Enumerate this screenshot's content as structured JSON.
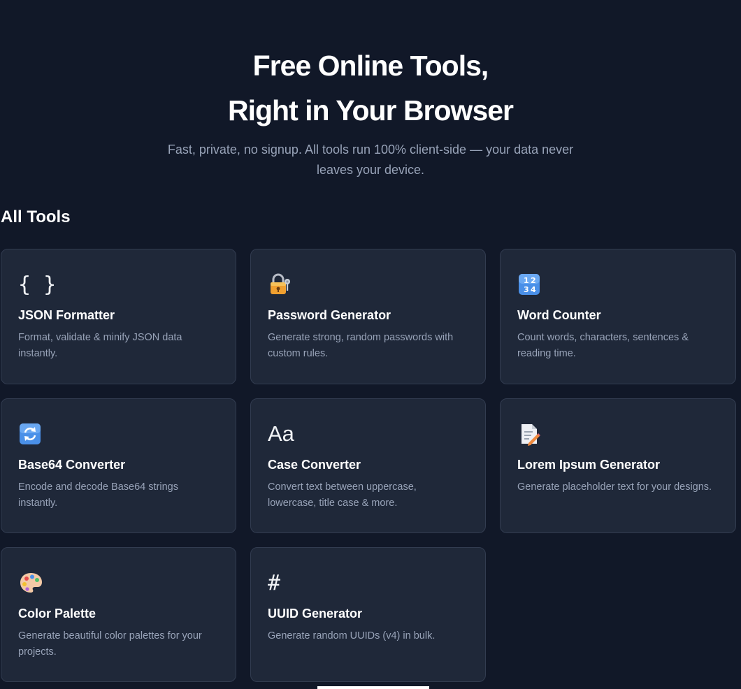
{
  "hero": {
    "title_line1": "Free Online Tools,",
    "title_line2": "Right in Your Browser",
    "subtitle": "Fast, private, no signup. All tools run 100% client-side — your data never leaves your device."
  },
  "section": {
    "title": "All Tools"
  },
  "tools": [
    {
      "icon": "braces-icon",
      "title": "JSON Formatter",
      "description": "Format, validate & minify JSON data instantly."
    },
    {
      "icon": "lock-key-icon",
      "title": "Password Generator",
      "description": "Generate strong, random passwords with custom rules."
    },
    {
      "icon": "numbers-icon",
      "title": "Word Counter",
      "description": "Count words, characters, sentences & reading time."
    },
    {
      "icon": "refresh-icon",
      "title": "Base64 Converter",
      "description": "Encode and decode Base64 strings instantly."
    },
    {
      "icon": "text-case-icon",
      "title": "Case Converter",
      "description": "Convert text between uppercase, lowercase, title case & more."
    },
    {
      "icon": "memo-icon",
      "title": "Lorem Ipsum Generator",
      "description": "Generate placeholder text for your designs."
    },
    {
      "icon": "palette-icon",
      "title": "Color Palette",
      "description": "Generate beautiful color palettes for your projects."
    },
    {
      "icon": "hash-icon",
      "title": "UUID Generator",
      "description": "Generate random UUIDs (v4) in bulk."
    }
  ],
  "icon_glyphs": {
    "braces": "{ }",
    "text_case": "Aa",
    "hash": "#"
  },
  "colors": {
    "background": "#111828",
    "card": "#1f2839",
    "card_border": "#323c50",
    "muted_text": "#98a3b8"
  }
}
